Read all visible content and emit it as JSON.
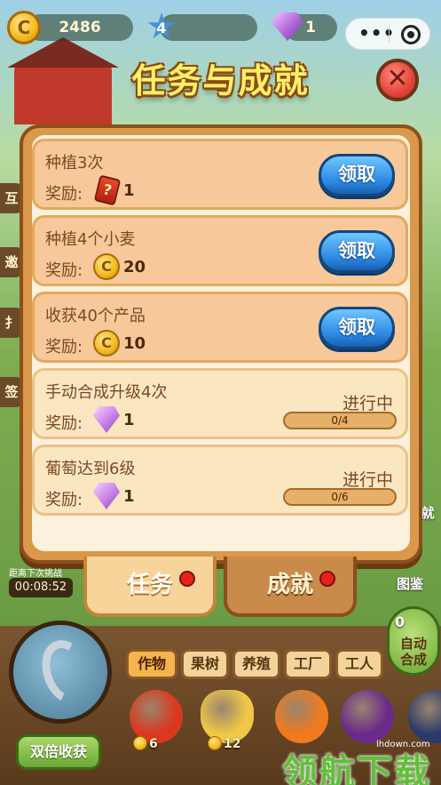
{
  "hud": {
    "coins": "2486",
    "level": "4",
    "gems": "1",
    "coin_glyph": "C"
  },
  "panel": {
    "title": "任务与成就",
    "close_glyph": "✕",
    "reward_label": "奖励:",
    "tasks": [
      {
        "title": "种植3次",
        "reward_type": "card",
        "reward_qty": "1",
        "status": "claimable",
        "button_label": "领取"
      },
      {
        "title": "种植4个小麦",
        "reward_type": "coin",
        "reward_qty": "20",
        "status": "claimable",
        "button_label": "领取"
      },
      {
        "title": "收获40个产品",
        "reward_type": "coin",
        "reward_qty": "10",
        "status": "claimable",
        "button_label": "领取"
      },
      {
        "title": "手动合成升级4次",
        "reward_type": "gem",
        "reward_qty": "1",
        "status": "in_progress",
        "status_text": "进行中",
        "progress_text": "0/4",
        "progress": 0
      },
      {
        "title": "葡萄达到6级",
        "reward_type": "gem",
        "reward_qty": "1",
        "status": "in_progress",
        "status_text": "进行中",
        "progress_text": "0/6",
        "progress": 0
      }
    ]
  },
  "tabs": {
    "tasks": "任务",
    "achievements": "成就"
  },
  "timer": {
    "label": "距离下次挑战",
    "value": "00:08:52"
  },
  "side": {
    "left_labels": [
      "互",
      "邀",
      "扌",
      "签"
    ],
    "right_label": "就",
    "atlas": "图鉴"
  },
  "bottom": {
    "double_harvest": "双倍收获",
    "categories": [
      "作物",
      "果树",
      "养殖",
      "工厂",
      "工人"
    ],
    "crops": [
      {
        "name": "tomato",
        "price": "6",
        "color": "#d9381e"
      },
      {
        "name": "wheat",
        "price": "12",
        "color": "#f0c846"
      },
      {
        "name": "carrot",
        "price": "",
        "color": "#f07a1e"
      },
      {
        "name": "grape",
        "price": "",
        "color": "#6a2a8a"
      },
      {
        "name": "blueberry",
        "price": "",
        "color": "#2a3a6a"
      }
    ],
    "auto_merge": "自动\n合成",
    "auto_count": "0"
  },
  "watermark": {
    "text": "领航下载",
    "url": "lhdown.com"
  }
}
